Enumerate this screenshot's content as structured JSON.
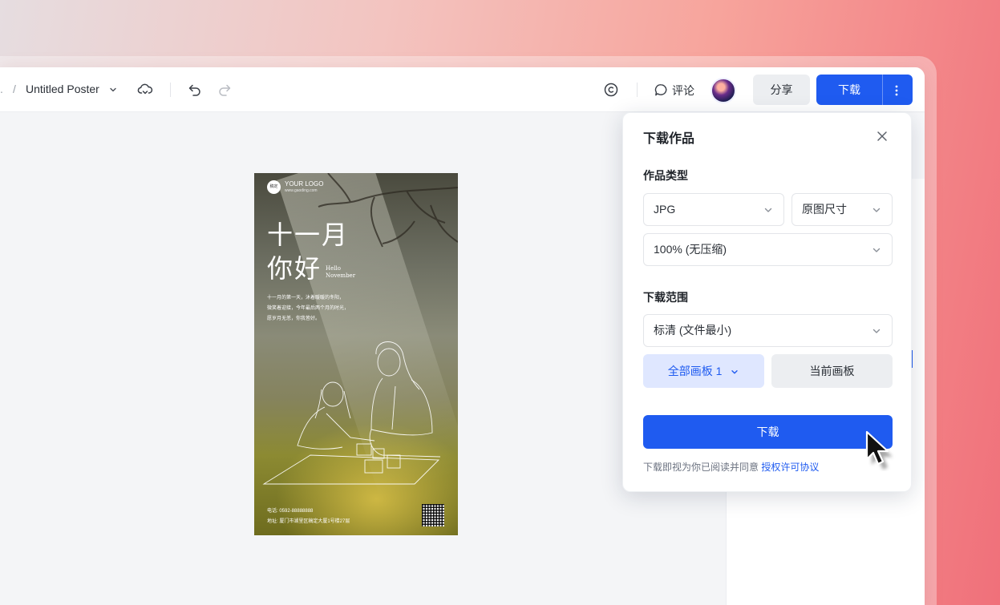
{
  "topbar": {
    "crumb_prefix": ".",
    "separator": "/",
    "doc_title": "Untitled Poster",
    "comment_label": "评论",
    "share_label": "分享",
    "download_label": "下载"
  },
  "poster": {
    "logo_badge": "稿定\n设计",
    "logo_text": "YOUR LOGO",
    "logo_url": "www.gaoding.com",
    "headline_1": "十一月",
    "headline_2": "你好",
    "hello": "Hello",
    "month": "November",
    "body_line_1": "十一月的第一天，沐着暖暖的冬阳，",
    "body_line_2": "微笑着迎接，今年最后两个月的时光，",
    "body_line_3": "愿岁月无恙，你我皆好。",
    "phone": "电话: 0592-88888888",
    "address": "地址: 厦门市湖里区稿定大厦1号楼27层"
  },
  "download_popup": {
    "title": "下载作品",
    "type_section_label": "作品类型",
    "format_value": "JPG",
    "size_value": "原图尺寸",
    "quality_value": "100% (无压缩)",
    "range_section_label": "下载范围",
    "resolution_value": "标清 (文件最小)",
    "all_boards_label": "全部画板 1",
    "current_board_label": "当前画板",
    "download_button": "下载",
    "agreement_text": "下载即视为你已阅读并同意",
    "agreement_link": "授权许可协议"
  },
  "colors": {
    "accent": "#1f5bf0",
    "accent_light": "#dfe7ff"
  },
  "icons": [
    "cloud-sync-icon",
    "undo-icon",
    "redo-icon",
    "copyright-icon",
    "comment-icon",
    "more-vertical-icon",
    "close-icon",
    "chevron-down-icon",
    "mouse-cursor-icon"
  ]
}
